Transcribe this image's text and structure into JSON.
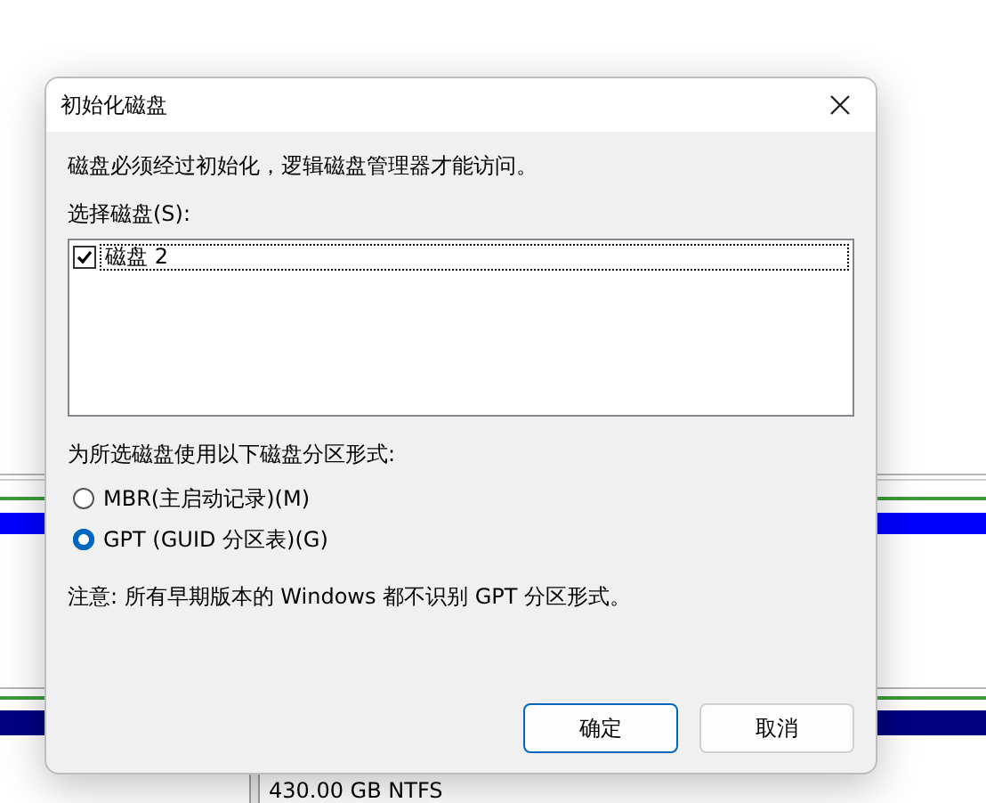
{
  "window": {
    "title": "初始化磁盘"
  },
  "message": "磁盘必须经过初始化，逻辑磁盘管理器才能访问。",
  "disk_list": {
    "label": "选择磁盘(S):",
    "items": [
      {
        "label": "磁盘 2",
        "checked": true,
        "selected": true
      }
    ]
  },
  "partition_style": {
    "label": "为所选磁盘使用以下磁盘分区形式:",
    "options": [
      {
        "label": "MBR(主启动记录)(M)",
        "selected": false
      },
      {
        "label": "GPT (GUID 分区表)(G)",
        "selected": true
      }
    ]
  },
  "note": "注意: 所有早期版本的 Windows 都不识别 GPT 分区形式。",
  "buttons": [
    {
      "label": "确定",
      "default": true
    },
    {
      "label": "取消",
      "default": false
    }
  ],
  "background": {
    "volume_info": "430.00 GB NTFS"
  }
}
